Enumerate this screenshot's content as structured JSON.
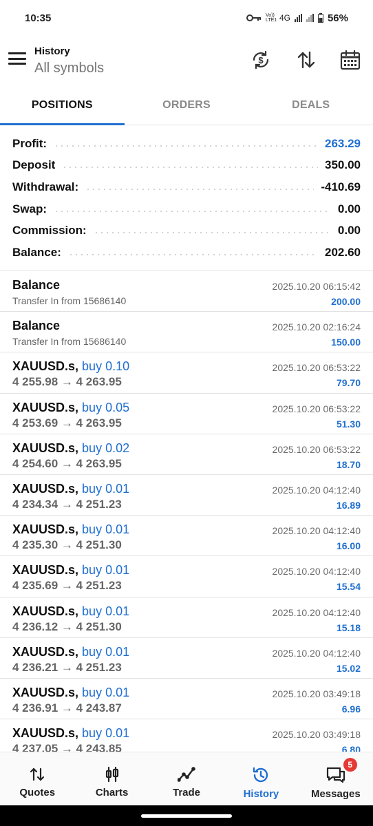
{
  "status_bar": {
    "time": "10:35",
    "network": "4G",
    "volte": "Vo)) LTE1",
    "battery": "56%"
  },
  "header": {
    "title": "History",
    "subtitle": "All symbols"
  },
  "tabs": [
    {
      "label": "POSITIONS",
      "active": true
    },
    {
      "label": "ORDERS",
      "active": false
    },
    {
      "label": "DEALS",
      "active": false
    }
  ],
  "summary": [
    {
      "label": "Profit:",
      "value": "263.29",
      "highlight": true
    },
    {
      "label": "Deposit",
      "value": "350.00",
      "highlight": false
    },
    {
      "label": "Withdrawal:",
      "value": "-410.69",
      "highlight": false
    },
    {
      "label": "Swap:",
      "value": "0.00",
      "highlight": false
    },
    {
      "label": "Commission:",
      "value": "0.00",
      "highlight": false
    },
    {
      "label": "Balance:",
      "value": "202.60",
      "highlight": false
    }
  ],
  "balance_entries": [
    {
      "title": "Balance",
      "comment": "Transfer In from 15686140",
      "time": "2025.10.20 06:15:42",
      "amount": "200.00"
    },
    {
      "title": "Balance",
      "comment": "Transfer In from 15686140",
      "time": "2025.10.20 02:16:24",
      "amount": "150.00"
    }
  ],
  "positions": [
    {
      "symbol": "XAUUSD.s,",
      "side": "buy 0.10",
      "prices": "4 255.98 → 4 263.95",
      "time": "2025.10.20 06:53:22",
      "profit": "79.70"
    },
    {
      "symbol": "XAUUSD.s,",
      "side": "buy 0.05",
      "prices": "4 253.69 → 4 263.95",
      "time": "2025.10.20 06:53:22",
      "profit": "51.30"
    },
    {
      "symbol": "XAUUSD.s,",
      "side": "buy 0.02",
      "prices": "4 254.60 → 4 263.95",
      "time": "2025.10.20 06:53:22",
      "profit": "18.70"
    },
    {
      "symbol": "XAUUSD.s,",
      "side": "buy 0.01",
      "prices": "4 234.34 → 4 251.23",
      "time": "2025.10.20 04:12:40",
      "profit": "16.89"
    },
    {
      "symbol": "XAUUSD.s,",
      "side": "buy 0.01",
      "prices": "4 235.30 → 4 251.30",
      "time": "2025.10.20 04:12:40",
      "profit": "16.00"
    },
    {
      "symbol": "XAUUSD.s,",
      "side": "buy 0.01",
      "prices": "4 235.69 → 4 251.23",
      "time": "2025.10.20 04:12:40",
      "profit": "15.54"
    },
    {
      "symbol": "XAUUSD.s,",
      "side": "buy 0.01",
      "prices": "4 236.12 → 4 251.30",
      "time": "2025.10.20 04:12:40",
      "profit": "15.18"
    },
    {
      "symbol": "XAUUSD.s,",
      "side": "buy 0.01",
      "prices": "4 236.21 → 4 251.23",
      "time": "2025.10.20 04:12:40",
      "profit": "15.02"
    },
    {
      "symbol": "XAUUSD.s,",
      "side": "buy 0.01",
      "prices": "4 236.91 → 4 243.87",
      "time": "2025.10.20 03:49:18",
      "profit": "6.96"
    },
    {
      "symbol": "XAUUSD.s,",
      "side": "buy 0.01",
      "prices": "4 237.05 → 4 243.85",
      "time": "2025.10.20 03:49:18",
      "profit": "6.80"
    }
  ],
  "bottom_nav": [
    {
      "label": "Quotes",
      "icon": "quotes-icon",
      "active": false
    },
    {
      "label": "Charts",
      "icon": "charts-icon",
      "active": false
    },
    {
      "label": "Trade",
      "icon": "trade-icon",
      "active": false
    },
    {
      "label": "History",
      "icon": "history-icon",
      "active": true
    },
    {
      "label": "Messages",
      "icon": "messages-icon",
      "active": false,
      "badge": "5"
    }
  ],
  "colors": {
    "accent": "#1f6fd1",
    "badge": "#e53935"
  }
}
